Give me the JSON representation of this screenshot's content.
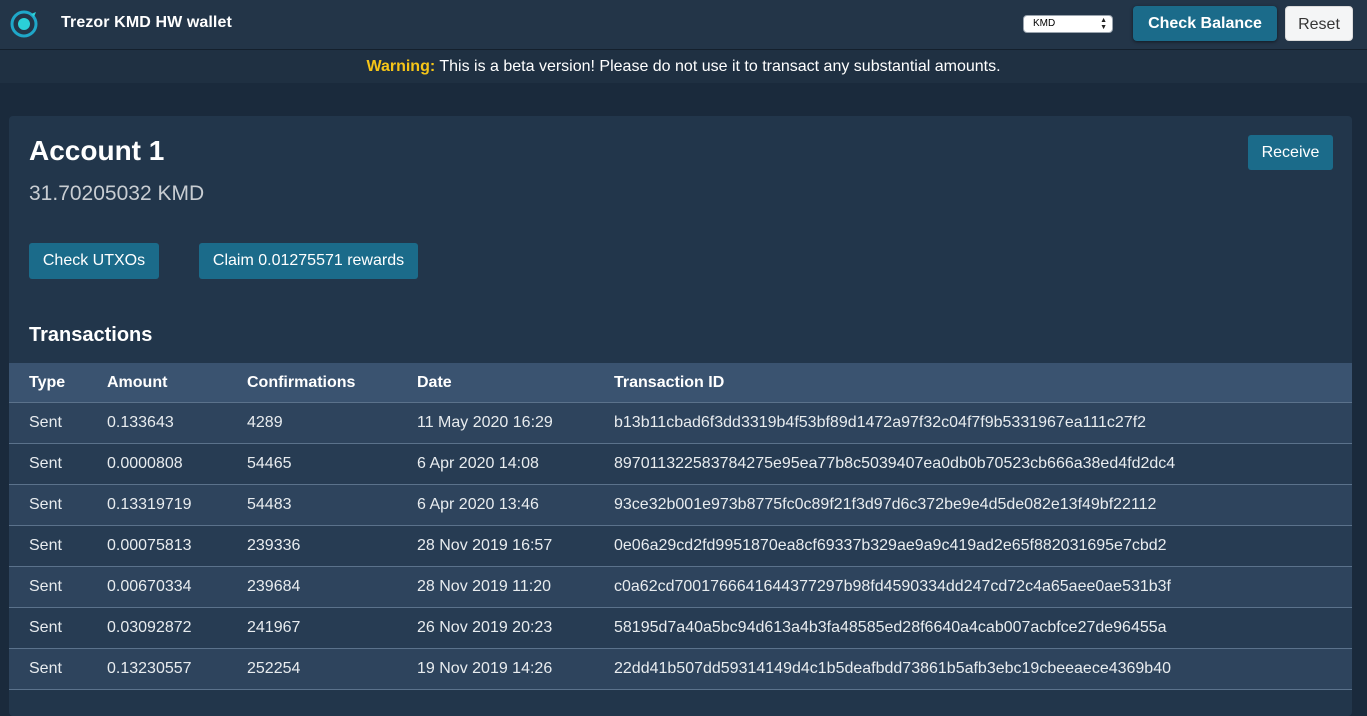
{
  "navbar": {
    "logo_icon": "komodo-logo-icon",
    "brand": "Trezor KMD HW wallet",
    "coin_select": "KMD",
    "check_balance_label": "Check Balance",
    "reset_label": "Reset"
  },
  "warning": {
    "label": "Warning:",
    "text": " This is a beta version! Please do not use it to transact any substantial amounts."
  },
  "account": {
    "title": "Account 1",
    "balance": "31.70205032 KMD",
    "receive_label": "Receive",
    "check_utxos_label": "Check UTXOs",
    "claim_label": "Claim 0.01275571 rewards"
  },
  "transactions": {
    "title": "Transactions",
    "columns": [
      "Type",
      "Amount",
      "Confirmations",
      "Date",
      "Transaction ID"
    ],
    "rows": [
      {
        "type": "Sent",
        "amount": "0.133643",
        "confirmations": "4289",
        "date": "11 May 2020 16:29",
        "txid": "b13b11cbad6f3dd3319b4f53bf89d1472a97f32c04f7f9b5331967ea111c27f2"
      },
      {
        "type": "Sent",
        "amount": "0.0000808",
        "confirmations": "54465",
        "date": "6 Apr 2020 14:08",
        "txid": "897011322583784275e95ea77b8c5039407ea0db0b70523cb666a38ed4fd2dc4"
      },
      {
        "type": "Sent",
        "amount": "0.13319719",
        "confirmations": "54483",
        "date": "6 Apr 2020 13:46",
        "txid": "93ce32b001e973b8775fc0c89f21f3d97d6c372be9e4d5de082e13f49bf22112"
      },
      {
        "type": "Sent",
        "amount": "0.00075813",
        "confirmations": "239336",
        "date": "28 Nov 2019 16:57",
        "txid": "0e06a29cd2fd9951870ea8cf69337b329ae9a9c419ad2e65f882031695e7cbd2"
      },
      {
        "type": "Sent",
        "amount": "0.00670334",
        "confirmations": "239684",
        "date": "28 Nov 2019 11:20",
        "txid": "c0a62cd700176664164437 7297b98fd4590334dd247cd72c4a65aee0ae531b3f"
      },
      {
        "type": "Sent",
        "amount": "0.03092872",
        "confirmations": "241967",
        "date": "26 Nov 2019 20:23",
        "txid": "58195d7a40a5bc94d613a4b3fa48585ed28f6640a4cab007acbfce27de96455a"
      },
      {
        "type": "Sent",
        "amount": "0.13230557",
        "confirmations": "252254",
        "date": "19 Nov 2019 14:26",
        "txid": "22dd41b507dd59314149d4c1b5deafbdd73861b5afb3ebc19cbeeaece4369b40"
      }
    ]
  }
}
